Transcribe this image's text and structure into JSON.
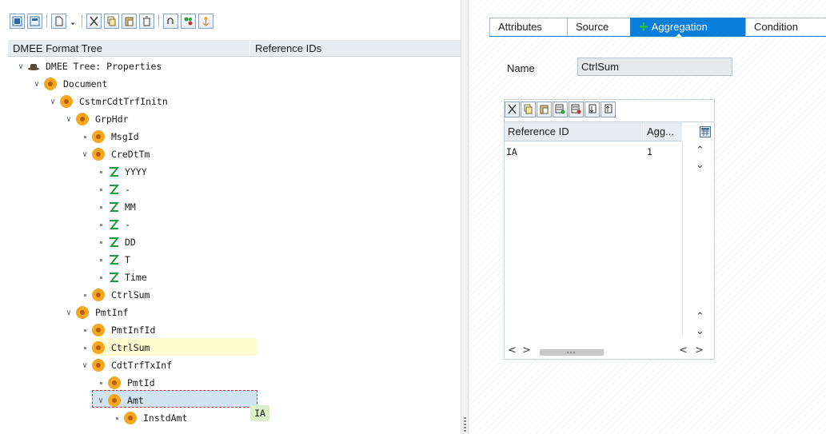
{
  "left": {
    "toolbar": {
      "buttons": [
        "expand-all-icon",
        "collapse-all-icon",
        "create-node-icon",
        "cut-icon",
        "copy-icon",
        "paste-icon",
        "delete-icon",
        "undo-icon",
        "run-icon",
        "flow-icon"
      ]
    },
    "tree_header": {
      "col_tree": "DMEE Format Tree",
      "col_ref": "Reference IDs"
    },
    "tree": {
      "root": "DMEE Tree: Properties",
      "n1": "Document",
      "n2": "CstmrCdtTrfInitn",
      "n3": "GrpHdr",
      "n4": "MsgId",
      "n5": "CreDtTm",
      "n6": "YYYY",
      "n7": "-",
      "n8": "MM",
      "n9": "-",
      "n10": "DD",
      "n11": "T",
      "n12": "Time",
      "n13": "CtrlSum",
      "n14": "PmtInf",
      "n15": "PmtInfId",
      "n16": "CtrlSum",
      "n17": "CdtTrfTxInf",
      "n18": "PmtId",
      "n19": "Amt",
      "n20": "InstdAmt",
      "ref_instdamt": "IA"
    }
  },
  "right": {
    "tabs": {
      "attributes": "Attributes",
      "source": "Source",
      "aggregation": "Aggregation",
      "condition": "Condition"
    },
    "name_label": "Name",
    "name_value": "CtrlSum",
    "grid": {
      "col_ref": "Reference ID",
      "col_agg": "Agg...",
      "rows": [
        {
          "ref": "IA",
          "agg": "1"
        }
      ]
    }
  },
  "colors": {
    "accent_tab": "#0a7fd9",
    "node_icon": "#f5a623",
    "selection": "#cfe3f0",
    "highlight": "#fefbd0",
    "ref_badge": "#d9f0c8"
  }
}
